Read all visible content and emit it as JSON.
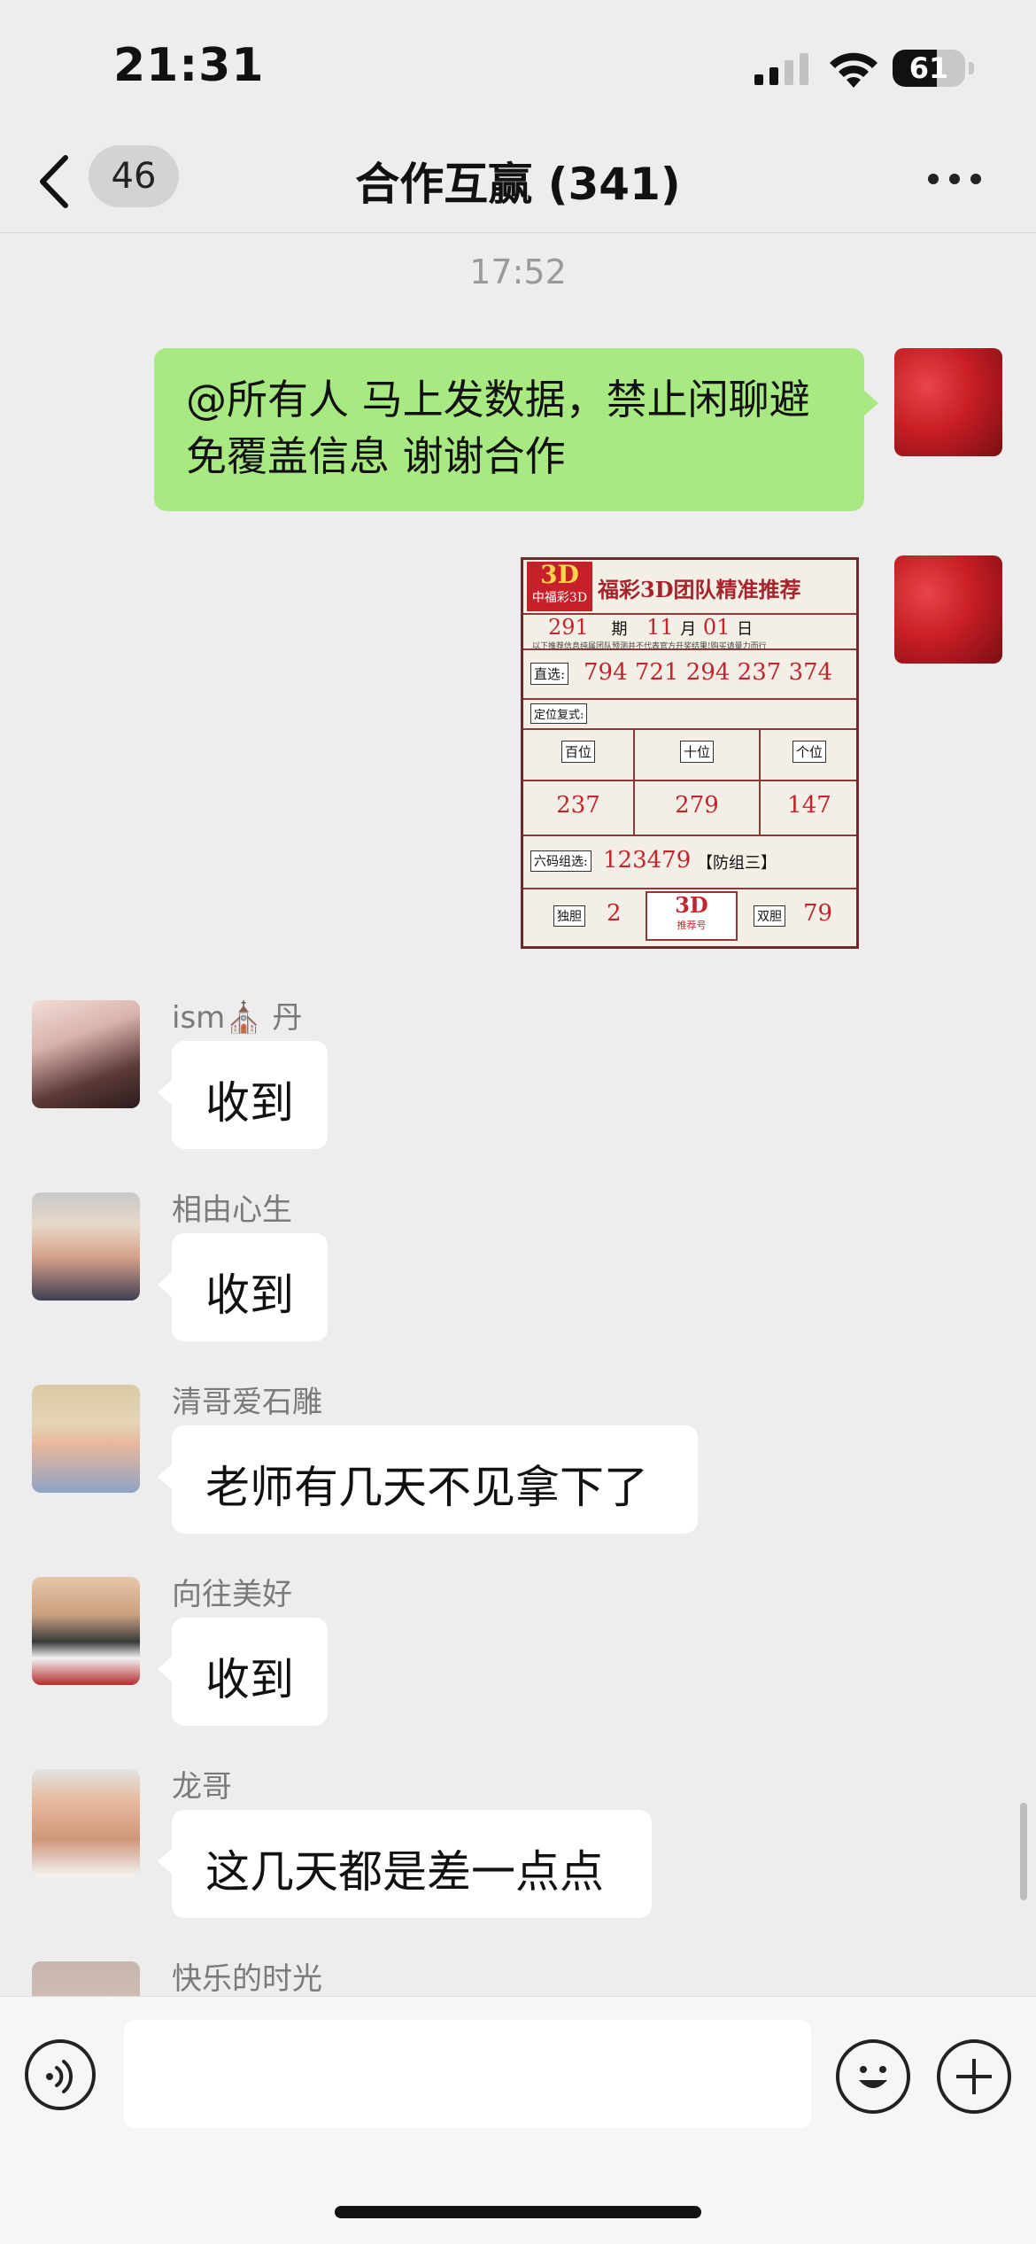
{
  "status_bar": {
    "time": "21:31",
    "battery": "61",
    "battery_level": 0.61
  },
  "nav": {
    "back_icon": "chevron-left-icon",
    "unread_count": "46",
    "title": "合作互赢 (341)",
    "more_icon": "more-dots-icon"
  },
  "chat": {
    "timestamp": "17:52",
    "my_message": "@所有人 马上发数据，禁止闲聊避免覆盖信息 谢谢合作",
    "image": {
      "logo_text": "3D",
      "logo_sub": "中福彩3D",
      "title": "福彩3D团队精准推荐",
      "issue": "291",
      "issue_label": "期",
      "month": "11",
      "month_label": "月",
      "day": "01",
      "day_label": "日",
      "disclaimer": "以下推荐信息纯属团队预测并不代表官方开奖结果!购买请量力而行",
      "direct_label": "直选:",
      "direct_numbers": "794 721 294 237 374",
      "position_label": "定位复式:",
      "col_hundreds": "百位",
      "col_tens": "十位",
      "col_units": "个位",
      "val_hundreds": "237",
      "val_tens": "279",
      "val_units": "147",
      "six_label": "六码组选:",
      "six_numbers": "123479",
      "six_note": "【防组三】",
      "single_label": "独胆",
      "single_value": "2",
      "center_top": "3D",
      "center_bottom": "推荐号",
      "double_label": "双胆",
      "double_value": "79"
    },
    "messages": [
      {
        "name": "ism⛪ 丹",
        "text": "收到"
      },
      {
        "name": "相由心生",
        "text": "收到"
      },
      {
        "name": "清哥爱石雕",
        "text": "老师有几天不见拿下了"
      },
      {
        "name": "向往美好",
        "text": "收到"
      },
      {
        "name": "龙哥",
        "text": "这几天都是差一点点"
      },
      {
        "name": "快乐的时光",
        "text": ""
      }
    ]
  },
  "input_bar": {
    "voice_icon": "voice-icon",
    "emoji_icon": "emoji-icon",
    "plus_icon": "plus-icon",
    "input_value": ""
  }
}
